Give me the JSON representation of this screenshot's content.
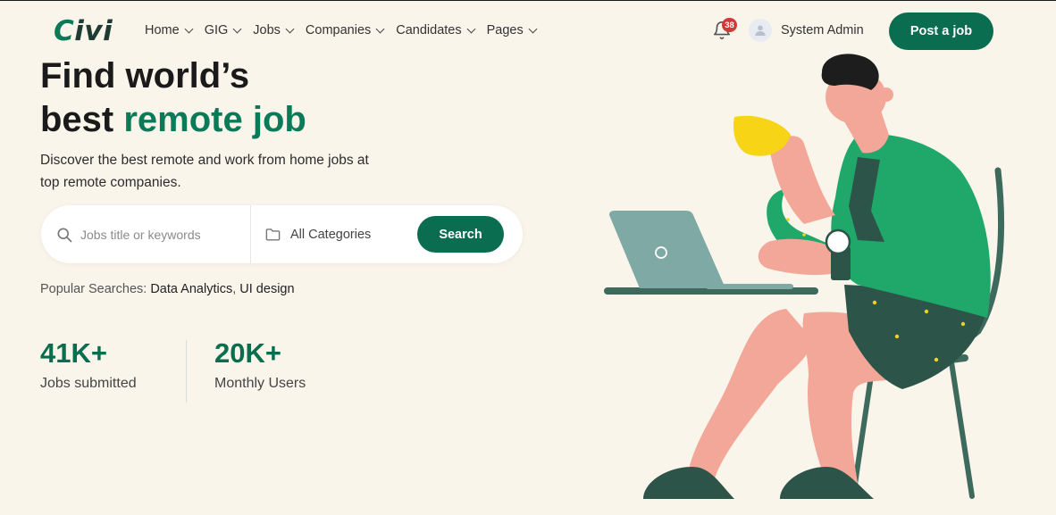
{
  "brand": {
    "logo_text": "Civi",
    "accent": "#0b6d4f",
    "background": "#faf5eb"
  },
  "nav": [
    {
      "label": "Home"
    },
    {
      "label": "GIG"
    },
    {
      "label": "Jobs"
    },
    {
      "label": "Companies"
    },
    {
      "label": "Candidates"
    },
    {
      "label": "Pages"
    }
  ],
  "notifications": {
    "count": "38",
    "icon": "bell-icon"
  },
  "user": {
    "name": "System Admin",
    "icon": "user-avatar-icon"
  },
  "header": {
    "post_job_label": "Post a job"
  },
  "hero": {
    "title_line1": "Find world’s",
    "title_line2_prefix": "best ",
    "title_line2_accent": "remote job",
    "subtitle": "Discover the best remote and work from home jobs at top remote companies."
  },
  "search": {
    "keyword_placeholder": "Jobs title or keywords",
    "category_value": "All Categories",
    "button_label": "Search"
  },
  "popular": {
    "label": "Popular Searches: ",
    "tags": [
      "Data Analytics",
      "UI design"
    ]
  },
  "stats": [
    {
      "value": "41K+",
      "label": "Jobs submitted"
    },
    {
      "value": "20K+",
      "label": "Monthly Users"
    }
  ]
}
